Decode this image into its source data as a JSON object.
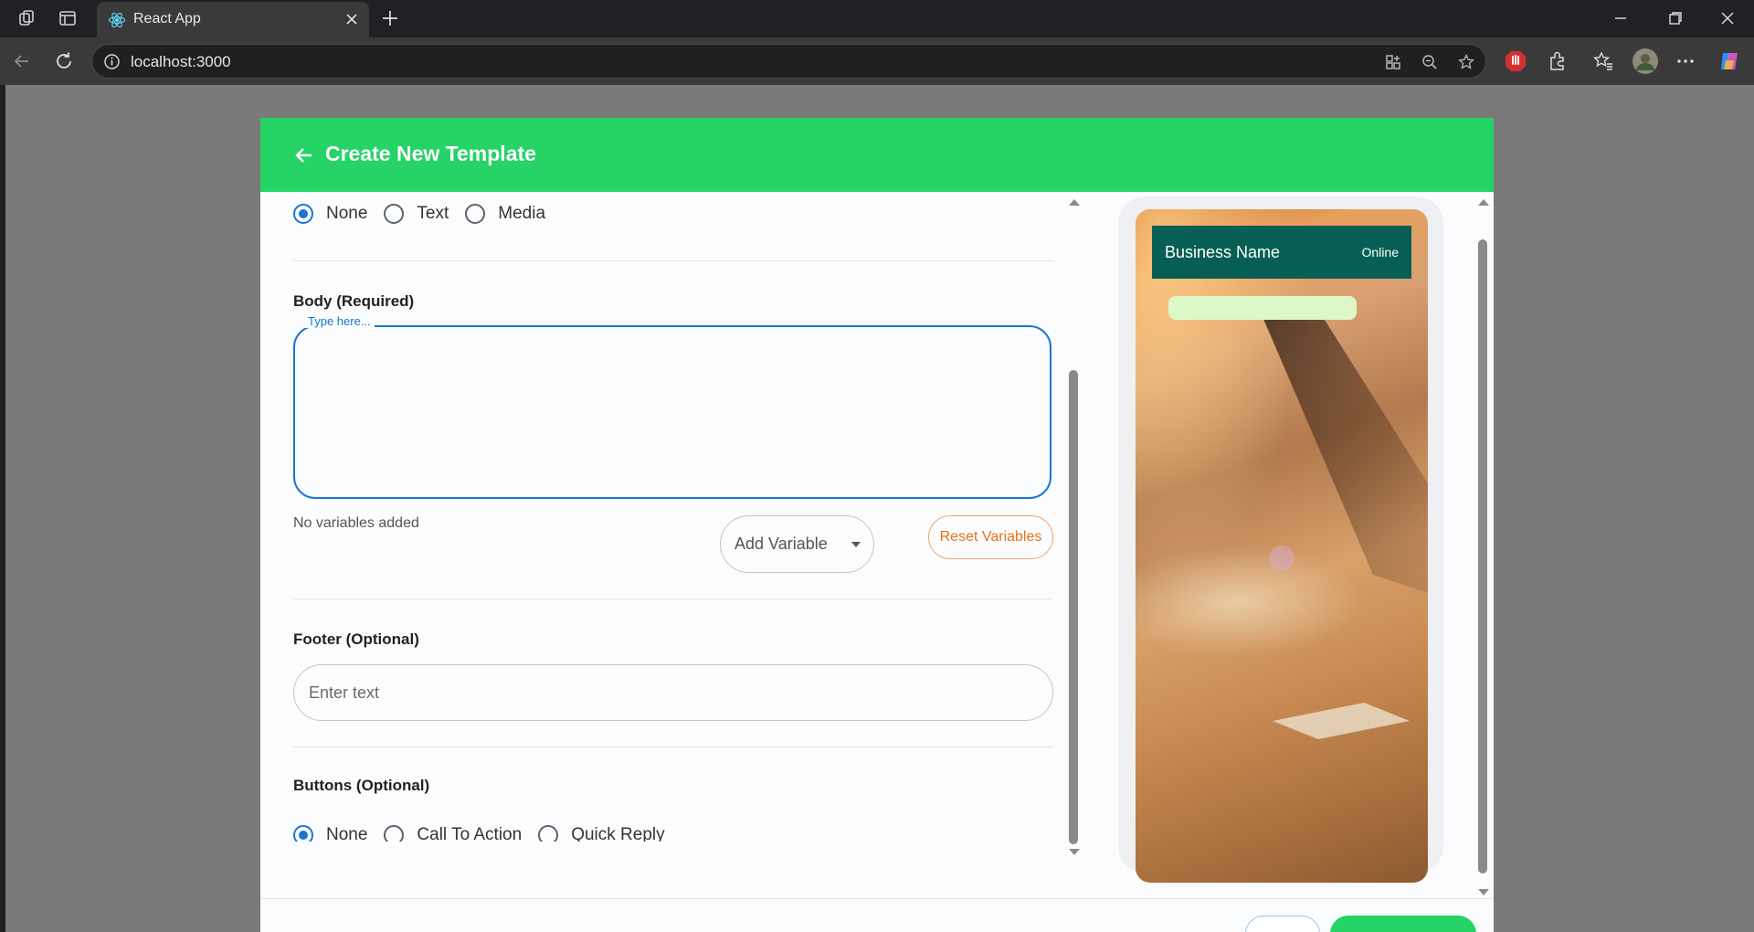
{
  "browser": {
    "tab_title": "React App",
    "url": "localhost:3000"
  },
  "modal": {
    "title": "Create New Template"
  },
  "header_type": {
    "options": [
      {
        "label": "None",
        "selected": true
      },
      {
        "label": "Text",
        "selected": false
      },
      {
        "label": "Media",
        "selected": false
      }
    ]
  },
  "body": {
    "title": "Body (Required)",
    "floating_label": "Type here...",
    "value": "",
    "no_variables": "No variables added",
    "add_variable_label": "Add Variable",
    "reset_label": "Reset Variables"
  },
  "footer_section": {
    "title": "Footer (Optional)",
    "placeholder": "Enter text"
  },
  "buttons_section": {
    "title": "Buttons (Optional)",
    "options": [
      {
        "label": "None",
        "selected": true
      },
      {
        "label": "Call To Action",
        "selected": false
      },
      {
        "label": "Quick Reply",
        "selected": false
      }
    ]
  },
  "preview": {
    "business_name": "Business Name",
    "status": "Online"
  },
  "colors": {
    "brand_green": "#25d366",
    "chat_header": "#075e54",
    "bubble": "#dcf8c6",
    "accent_blue": "#1976d2",
    "reset_orange": "#e8711c"
  }
}
